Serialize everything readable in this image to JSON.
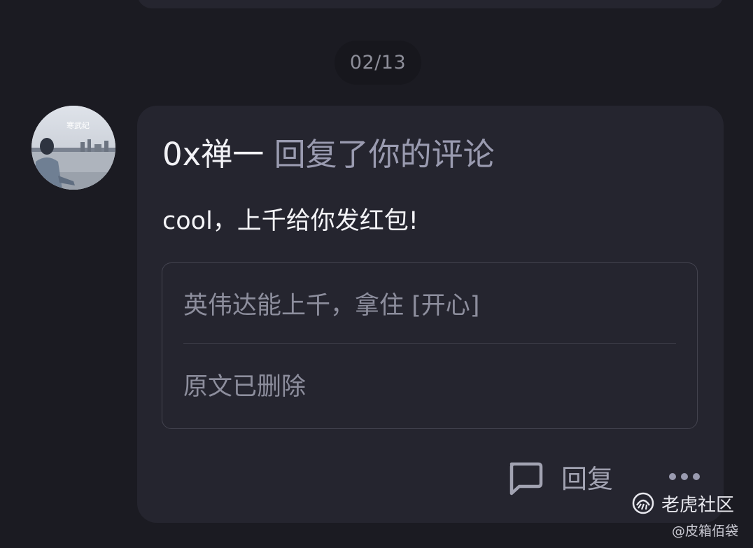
{
  "date_label": "02/13",
  "notification": {
    "username": "0x禅一",
    "action": " 回复了你的评论",
    "comment": "cool，上千给你发红包!",
    "quoted_comment": "英伟达能上千，拿住 [开心]",
    "original_post": "原文已删除"
  },
  "actions": {
    "reply_label": "回复",
    "reply_icon": "comment-bubble-icon",
    "more_icon": "more-dots-icon"
  },
  "watermark": {
    "brand": "老虎社区",
    "author": "@皮箱佰袋"
  },
  "avatar_overlay_text": "寒武纪",
  "colors": {
    "background": "#1b1b22",
    "card": "#25252f",
    "muted": "#9a9bb0",
    "text": "#f2f2f6"
  }
}
